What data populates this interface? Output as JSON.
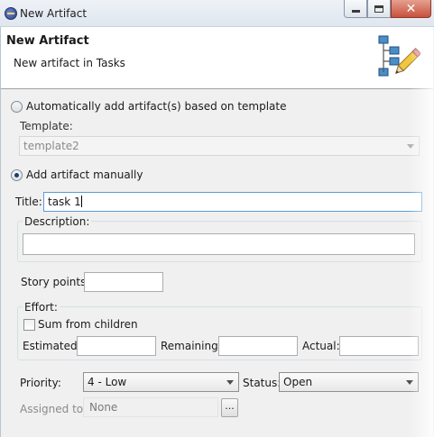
{
  "window": {
    "title": "New Artifact",
    "icon": "eclipse-icon",
    "controls": {
      "minimize": "minimize-icon",
      "maximize": "maximize-icon",
      "close": "✕"
    }
  },
  "banner": {
    "title": "New Artifact",
    "subtitle": "New artifact in Tasks",
    "icon": "hierarchy-pencil-icon"
  },
  "form": {
    "template_mode": {
      "label": "Automatically add artifact(s) based on template",
      "selected": false,
      "template_label": "Template:",
      "template_value": "template2"
    },
    "manual_mode": {
      "label": "Add artifact manually",
      "selected": true
    },
    "title": {
      "label": "Title:",
      "value": "task 1"
    },
    "description": {
      "label": "Description:",
      "value": ""
    },
    "story_points": {
      "label": "Story points:",
      "value": ""
    },
    "effort": {
      "label": "Effort:",
      "sum_from_children": {
        "label": "Sum from children",
        "checked": false
      },
      "estimated": {
        "label": "Estimated:",
        "value": ""
      },
      "remaining": {
        "label": "Remaining:",
        "value": ""
      },
      "actual": {
        "label": "Actual:",
        "value": ""
      }
    },
    "priority": {
      "label": "Priority:",
      "value": "4 - Low"
    },
    "status": {
      "label": "Status:",
      "value": "Open"
    },
    "assigned_to": {
      "label": "Assigned to:",
      "value": "None",
      "browse_label": "..."
    }
  }
}
